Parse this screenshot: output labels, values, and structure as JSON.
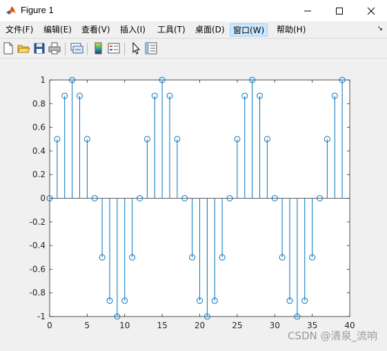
{
  "window": {
    "title": "Figure 1"
  },
  "menu": {
    "items": [
      {
        "label": "文件(F)"
      },
      {
        "label": "编辑(E)"
      },
      {
        "label": "查看(V)"
      },
      {
        "label": "插入(I)"
      },
      {
        "label": "工具(T)"
      },
      {
        "label": "桌面(D)"
      },
      {
        "label": "窗口(W)"
      },
      {
        "label": "帮助(H)"
      }
    ],
    "active_index": 6
  },
  "toolbar": {
    "buttons": [
      "new-figure-icon",
      "open-file-icon",
      "save-icon",
      "print-icon",
      "link-plot-icon",
      "insert-colorbar-icon",
      "insert-legend-icon",
      "edit-plot-arrow-icon",
      "property-inspector-icon"
    ]
  },
  "chart_data": {
    "type": "stem",
    "title": "",
    "xlabel": "",
    "ylabel": "",
    "xlim": [
      0,
      40
    ],
    "ylim": [
      -1,
      1
    ],
    "x_ticks": [
      "0",
      "5",
      "10",
      "15",
      "20",
      "25",
      "30",
      "35",
      "40"
    ],
    "y_ticks": [
      "1",
      "0.8",
      "0.6",
      "0.4",
      "0.2",
      "0",
      "-0.2",
      "-0.4",
      "-0.6",
      "-0.8",
      "-1"
    ],
    "color": "#0072bd",
    "x": [
      0,
      1,
      2,
      3,
      4,
      5,
      6,
      7,
      8,
      9,
      10,
      11,
      12,
      13,
      14,
      15,
      16,
      17,
      18,
      19,
      20,
      21,
      22,
      23,
      24,
      25,
      26,
      27,
      28,
      29,
      30,
      31,
      32,
      33,
      34,
      35,
      36,
      37,
      38,
      39
    ],
    "y": [
      0,
      0.5,
      0.866,
      1,
      0.866,
      0.5,
      0,
      -0.5,
      -0.866,
      -1,
      -0.866,
      -0.5,
      0,
      0.5,
      0.866,
      1,
      0.866,
      0.5,
      0,
      -0.5,
      -0.866,
      -1,
      -0.866,
      -0.5,
      0,
      0.5,
      0.866,
      1,
      0.866,
      0.5,
      0,
      -0.5,
      -0.866,
      -1,
      -0.866,
      -0.5,
      0,
      0.5,
      0.866,
      1
    ]
  },
  "watermark": "CSDN @清泉_流响"
}
